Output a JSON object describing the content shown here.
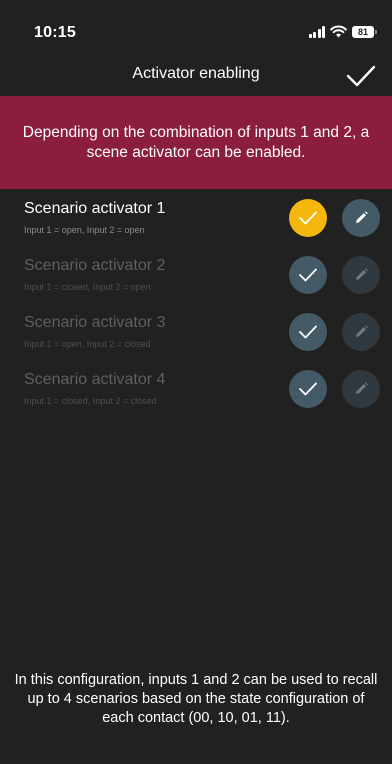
{
  "status_bar": {
    "time": "10:15",
    "battery": "81"
  },
  "nav": {
    "title": "Activator enabling",
    "confirm_icon": "checkmark-icon"
  },
  "banner": {
    "text": "Depending on the combination of inputs 1 and 2, a scene activator can be enabled."
  },
  "scenarios": [
    {
      "title": "Scenario activator 1",
      "subtitle": "Input 1 = open, Input 2 = open",
      "enabled": true
    },
    {
      "title": "Scenario activator 2",
      "subtitle": "Input 1 = closed, Input 2 = open",
      "enabled": false
    },
    {
      "title": "Scenario activator 3",
      "subtitle": "Input 1 = open, Input 2 = closed",
      "enabled": false
    },
    {
      "title": "Scenario activator 4",
      "subtitle": "Input 1 = closed, Input 2 = closed",
      "enabled": false
    }
  ],
  "footer": {
    "text": "In this configuration, inputs 1 and 2 can be used to recall up to 4 scenarios based on the state configuration of each contact (00, 10, 01, 11)."
  },
  "colors": {
    "background": "#212121",
    "banner": "#8b1e3f",
    "active_check": "#f5b70d",
    "inactive_button": "#445a66"
  }
}
